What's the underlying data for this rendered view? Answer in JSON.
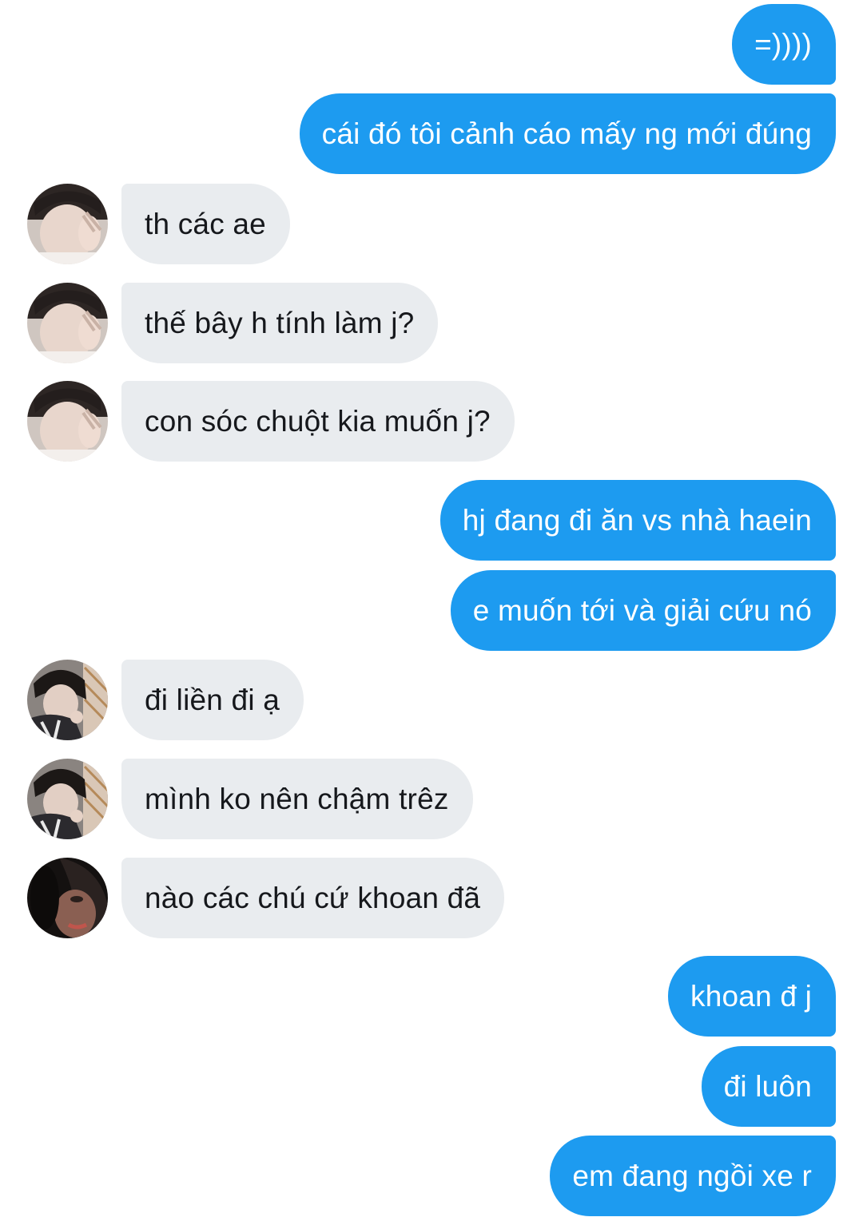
{
  "messages": [
    {
      "side": "out",
      "text": "=))))"
    },
    {
      "side": "out",
      "text": "cái đó tôi cảnh cáo mấy ng mới đúng"
    },
    {
      "side": "in",
      "avatar": "avatar-user-a",
      "text": "th các ae"
    },
    {
      "side": "in",
      "avatar": "avatar-user-a",
      "text": "thế bây h tính làm j?"
    },
    {
      "side": "in",
      "avatar": "avatar-user-a",
      "text": "con sóc chuột kia muốn j?"
    },
    {
      "side": "out",
      "text": "hj đang đi ăn vs nhà haein"
    },
    {
      "side": "out",
      "text": "e muốn tới và giải cứu nó"
    },
    {
      "side": "in",
      "avatar": "avatar-user-b",
      "text": "đi liền đi ạ"
    },
    {
      "side": "in",
      "avatar": "avatar-user-b",
      "text": "mình ko nên chậm trêz"
    },
    {
      "side": "in",
      "avatar": "avatar-user-c",
      "text": "nào các chú cứ khoan đã"
    },
    {
      "side": "out",
      "text": "khoan đ j"
    },
    {
      "side": "out",
      "text": "đi luôn"
    },
    {
      "side": "out",
      "text": "em đang ngồi xe r"
    }
  ],
  "colors": {
    "outgoing_bubble": "#1d9bf0",
    "incoming_bubble": "#e9ecef"
  }
}
